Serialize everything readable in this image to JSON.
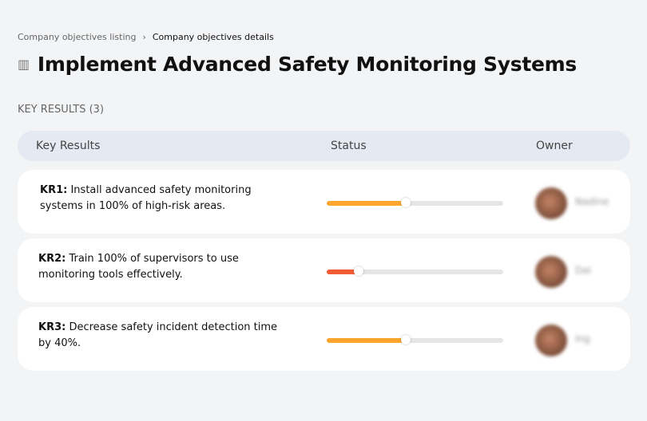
{
  "breadcrumb": {
    "items": [
      "Company objectives listing",
      "Company objectives details"
    ],
    "separator": "›"
  },
  "title": "Implement Advanced Safety Monitoring Systems",
  "title_icon": "building-chart-icon",
  "section": "KEY RESULTS (3)",
  "columns": [
    "Key Results",
    "Status",
    "Owner"
  ],
  "rows": [
    {
      "code": "KR1:",
      "text": "Install advanced safety monitoring systems in 100% of high-risk areas.",
      "progress": 45,
      "color": "#fda52f",
      "owner": "Nadine"
    },
    {
      "code": "KR2:",
      "text": "Train 100% of supervisors to use monitoring tools effectively.",
      "progress": 18,
      "color": "#f25b34",
      "owner": "Dai"
    },
    {
      "code": "KR3:",
      "text": "Decrease safety incident detection time by 40%.",
      "progress": 45,
      "color": "#fda52f",
      "owner": "Ing"
    }
  ]
}
